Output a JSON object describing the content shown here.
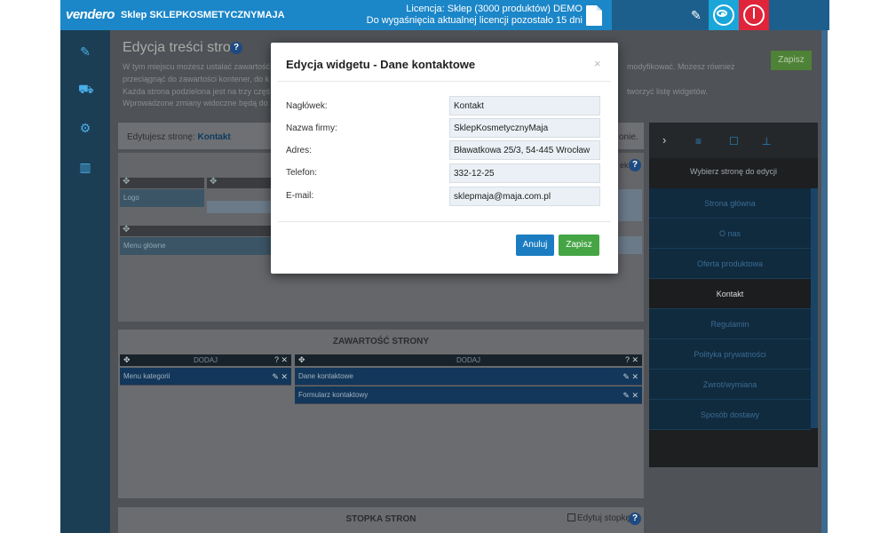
{
  "topbar": {
    "logo": "vendero",
    "shop_name": "Sklep SKLEPKOSMETYCZNYMAJA",
    "license_line1": "Licencja: Sklep (3000 produktów) DEMO",
    "license_line2": "Do wygaśnięcia aktualnej licencji pozostało 15 dni",
    "icons": [
      "document-icon",
      "pencil-icon",
      "eye-icon",
      "power-icon"
    ],
    "colors": {
      "bar": "#1b86c8",
      "dark": "#1d5f8c",
      "eye": "#1aa6d9",
      "power": "#e0243a"
    }
  },
  "sidebar": {
    "icons": [
      "edit-icon",
      "cart-icon",
      "settings-icon",
      "stats-icon"
    ]
  },
  "page": {
    "title": "Edycja treści stron",
    "intro_lines": [
      "W tym miejscu możesz ustalać zawartość",
      "przeciągnąć do zawartości kontener, do k",
      "Każda strona podzielona jest na trzy częś",
      "Wprowadzone zmiany widoczne będą do"
    ],
    "intro_right_1": "modyfikować. Możesz również",
    "intro_right_2": "tworzyć listę widgetów.",
    "save_label": "Zapisz",
    "editing_label": "Edytujesz stronę:",
    "editing_page": "Kontakt",
    "editing_suffix": "onie.",
    "help_partial": "ek"
  },
  "layout": {
    "logo_block": "Logo",
    "menu_block": "Menu główne"
  },
  "content": {
    "title": "ZAWARTOŚĆ STRONY",
    "add_label": "DODAJ",
    "left_column": [
      "Menu kategorii"
    ],
    "right_column": [
      "Dane kontaktowe",
      "Formularz kontaktowy"
    ]
  },
  "footer": {
    "title": "STOPKA STRON",
    "edit_label": "Edytuj stopkę"
  },
  "right_panel": {
    "title": "Wybierz stronę do edycji",
    "pages": [
      "Strona główna",
      "O nas",
      "Oferta produktowa",
      "Kontakt",
      "Regulamin",
      "Polityka prywatności",
      "Zwrot/wymiana",
      "Sposób dostawy"
    ],
    "active": "Kontakt"
  },
  "modal": {
    "title": "Edycja widgetu - Dane kontaktowe",
    "close": "×",
    "fields": [
      {
        "label": "Nagłówek:",
        "value": "Kontakt"
      },
      {
        "label": "Nazwa firmy:",
        "value": "SklepKosmetycznyMaja"
      },
      {
        "label": "Adres:",
        "value": "Bławatkowa 25/3, 54-445 Wrocław"
      },
      {
        "label": "Telefon:",
        "value": "332-12-25"
      },
      {
        "label": "E-mail:",
        "value": "sklepmaja@maja.com.pl"
      }
    ],
    "cancel_label": "Anuluj",
    "save_label": "Zapisz"
  }
}
